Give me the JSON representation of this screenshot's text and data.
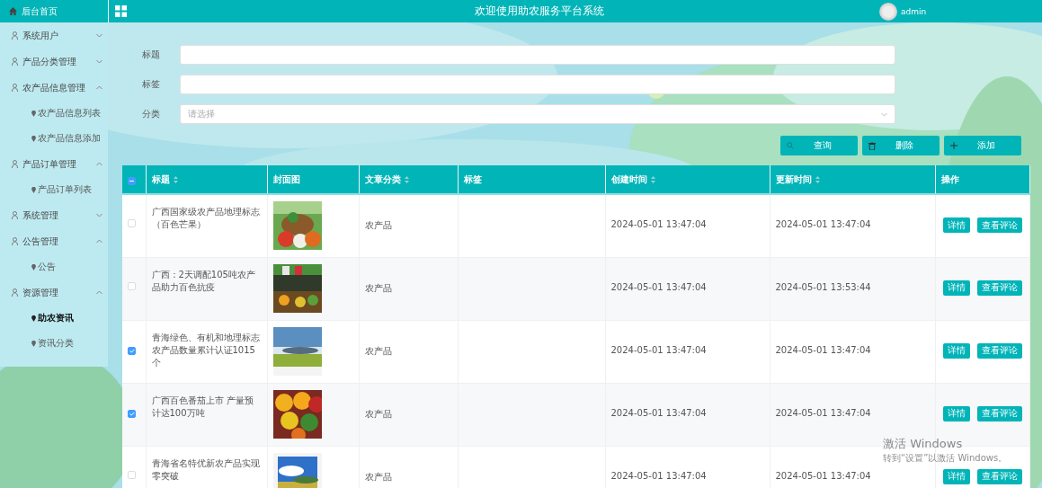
{
  "topbar": {
    "title": "欢迎使用助农服务平台系统",
    "user": "admin"
  },
  "sidebar": {
    "home": "后台首页",
    "menus": [
      {
        "label": "系统用户",
        "expanded": false
      },
      {
        "label": "产品分类管理",
        "expanded": false
      },
      {
        "label": "农产品信息管理",
        "expanded": true,
        "children": [
          {
            "label": "农产品信息列表",
            "selected": false
          },
          {
            "label": "农产品信息添加",
            "selected": false
          }
        ]
      },
      {
        "label": "产品订单管理",
        "expanded": true,
        "children": [
          {
            "label": "产品订单列表",
            "selected": false
          }
        ]
      },
      {
        "label": "系统管理",
        "expanded": false
      },
      {
        "label": "公告管理",
        "expanded": true,
        "children": [
          {
            "label": "公告",
            "selected": false
          }
        ]
      },
      {
        "label": "资源管理",
        "expanded": true,
        "children": [
          {
            "label": "助农资讯",
            "selected": true
          },
          {
            "label": "资讯分类",
            "selected": false
          }
        ]
      }
    ]
  },
  "filters": [
    {
      "kind": "text",
      "label": "标题"
    },
    {
      "kind": "text",
      "label": "标签"
    },
    {
      "kind": "select",
      "label": "分类",
      "placeholder": "请选择"
    }
  ],
  "buttons": [
    {
      "kind": "search",
      "label": "查询"
    },
    {
      "kind": "delete",
      "label": "删除"
    },
    {
      "kind": "add",
      "label": "添加"
    }
  ],
  "table": {
    "header_checkbox": {
      "indeterminate": true
    },
    "columns": [
      {
        "label": "标题",
        "sortable": true
      },
      {
        "label": "封面图",
        "sortable": false
      },
      {
        "label": "文章分类",
        "sortable": true
      },
      {
        "label": "标签",
        "sortable": false
      },
      {
        "label": "创建时间",
        "sortable": true
      },
      {
        "label": "更新时间",
        "sortable": true
      },
      {
        "label": "操作",
        "sortable": false
      }
    ],
    "rows": [
      {
        "checked": false,
        "title": "广西国家级农产品地理标志（百色芒果）",
        "category": "农产品",
        "created": "2024-05-01 13:47:04",
        "updated": "2024-05-01 13:47:04",
        "actions": [
          "详情",
          "查看评论"
        ]
      },
      {
        "checked": false,
        "title": "广西：2天调配105吨农产品助力百色抗疫",
        "category": "农产品",
        "created": "2024-05-01 13:47:04",
        "updated": "2024-05-01 13:53:44",
        "actions": [
          "详情",
          "查看评论"
        ]
      },
      {
        "checked": true,
        "title": "青海绿色、有机和地理标志农产品数量累计认证1015个",
        "category": "农产品",
        "created": "2024-05-01 13:47:04",
        "updated": "2024-05-01 13:47:04",
        "actions": [
          "详情",
          "查看评论"
        ]
      },
      {
        "checked": true,
        "title": "广西百色番茄上市 产量预计达100万吨",
        "category": "农产品",
        "created": "2024-05-01 13:47:04",
        "updated": "2024-05-01 13:47:04",
        "actions": [
          "详情",
          "查看评论"
        ]
      },
      {
        "checked": false,
        "title": "青海省名特优新农产品实现零突破",
        "category": "农产品",
        "created": "2024-05-01 13:47:04",
        "updated": "2024-05-01 13:47:04",
        "actions": [
          "详情",
          "查看评论"
        ]
      }
    ]
  },
  "os_notice": {
    "title": "激活 Windows",
    "hint": "转到“设置”以激活 Windows。"
  }
}
